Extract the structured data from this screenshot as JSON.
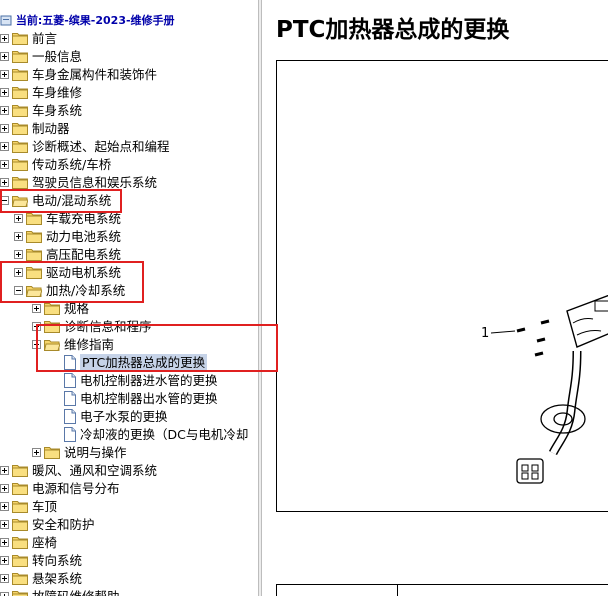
{
  "breadcrumb": "当前:五菱-缤果-2023-维修手册",
  "tree": {
    "level0": [
      "前言",
      "一般信息",
      "车身金属构件和装饰件",
      "车身维修",
      "车身系统",
      "制动器",
      "诊断概述、起始点和编程",
      "传动系统/车桥",
      "驾驶员信息和娱乐系统"
    ],
    "electric": "电动/混动系统",
    "electric_children": [
      "车载充电系统",
      "动力电池系统",
      "高压配电系统",
      "驱动电机系统"
    ],
    "heating": "加热/冷却系统",
    "heating_children": [
      "规格",
      "诊断信息和程序"
    ],
    "repair_guide": "维修指南",
    "repair_pages": [
      "PTC加热器总成的更换",
      "电机控制器进水管的更换",
      "电机控制器出水管的更换",
      "电子水泵的更换",
      "冷却液的更换（DC与电机冷却"
    ],
    "description": "说明与操作",
    "level0_after": [
      "暖风、通风和空调系统",
      "电源和信号分布",
      "车顶",
      "安全和防护",
      "座椅",
      "转向系统",
      "悬架系统",
      "故障码维修帮助"
    ]
  },
  "content": {
    "title": "PTC加热器总成的更换",
    "figure_callout": "1"
  }
}
